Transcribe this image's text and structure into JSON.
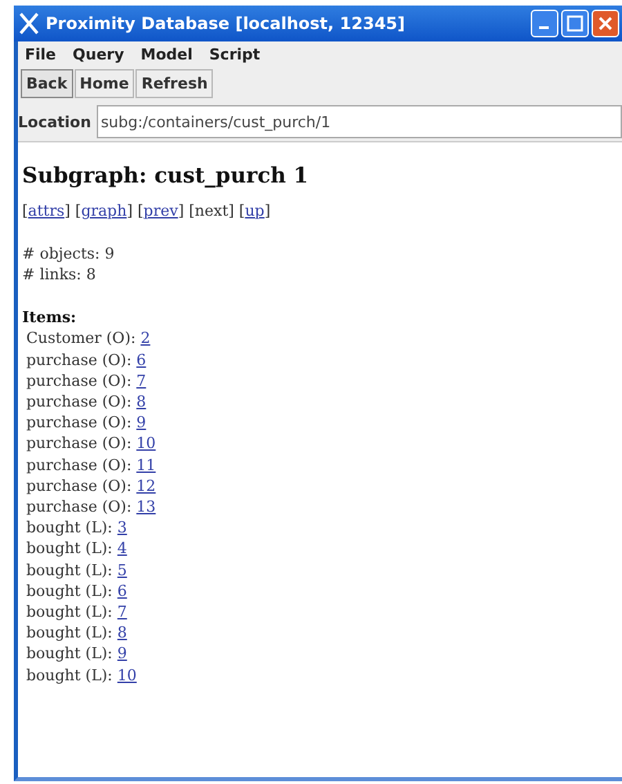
{
  "window": {
    "title": "Proximity Database [localhost, 12345]"
  },
  "menu": [
    "File",
    "Query",
    "Model",
    "Script"
  ],
  "toolbar": [
    {
      "label": "Back",
      "selected": true
    },
    {
      "label": "Home",
      "selected": false
    },
    {
      "label": "Refresh",
      "selected": false
    }
  ],
  "location": {
    "label": "Location",
    "value": "subg:/containers/cust_purch/1"
  },
  "page": {
    "heading": "Subgraph: cust_purch 1",
    "nav": [
      {
        "open": "[",
        "label": "attrs",
        "close": "]",
        "link": true
      },
      {
        "open": "[",
        "label": "graph",
        "close": "]",
        "link": true
      },
      {
        "open": "[",
        "label": "prev",
        "close": "]",
        "link": true
      },
      {
        "open": "[",
        "label": "next",
        "close": "]",
        "link": false
      },
      {
        "open": "[",
        "label": "up",
        "close": "]",
        "link": true
      }
    ],
    "stats": [
      "# objects: 9",
      "# links: 8"
    ],
    "items_heading": "Items:",
    "items": [
      {
        "label": "Customer (O): ",
        "link": "2"
      },
      {
        "label": "purchase (O): ",
        "link": "6"
      },
      {
        "label": "purchase (O): ",
        "link": "7"
      },
      {
        "label": "purchase (O): ",
        "link": "8"
      },
      {
        "label": "purchase (O): ",
        "link": "9"
      },
      {
        "label": "purchase (O): ",
        "link": "10"
      },
      {
        "label": "purchase (O): ",
        "link": "11"
      },
      {
        "label": "purchase (O): ",
        "link": "12"
      },
      {
        "label": "purchase (O): ",
        "link": "13"
      },
      {
        "label": "bought (L): ",
        "link": "3"
      },
      {
        "label": "bought (L): ",
        "link": "4"
      },
      {
        "label": "bought (L): ",
        "link": "5"
      },
      {
        "label": "bought (L): ",
        "link": "6"
      },
      {
        "label": "bought (L): ",
        "link": "7"
      },
      {
        "label": "bought (L): ",
        "link": "8"
      },
      {
        "label": "bought (L): ",
        "link": "9"
      },
      {
        "label": "bought (L): ",
        "link": "10"
      }
    ]
  }
}
